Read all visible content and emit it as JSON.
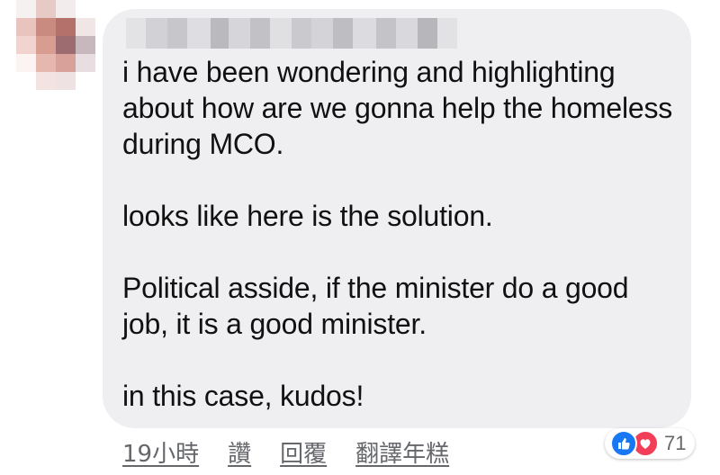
{
  "comment": {
    "paragraphs": [
      "i have been wondering and highlighting about how are we gonna help the homeless during MCO.",
      "looks like here is the solution.",
      "Political asside, if the minister do a good job, it is a good minister.",
      "in this case, kudos!"
    ]
  },
  "actions": {
    "timestamp": "19小時",
    "like_label": "讚",
    "reply_label": "回覆",
    "translate_label": "翻譯年糕"
  },
  "reactions": {
    "count": "71",
    "icons": [
      "like-icon",
      "love-icon"
    ],
    "like_color": "#1877f2",
    "love_color": "#f33e58"
  },
  "colors": {
    "bubble_background": "#efeff2",
    "text": "#111111",
    "meta_text": "#65676b"
  }
}
